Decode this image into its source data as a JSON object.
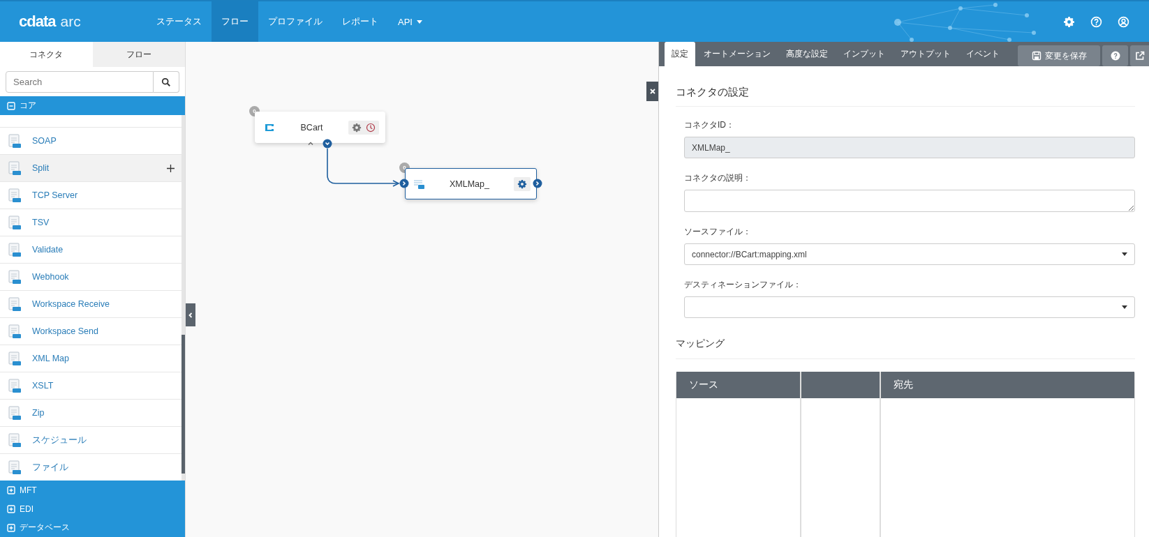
{
  "header": {
    "logo": {
      "brand": "cdata",
      "product": "arc"
    },
    "nav": [
      {
        "label": "ステータス",
        "selected": false,
        "dropdown": false
      },
      {
        "label": "フロー",
        "selected": true,
        "dropdown": false
      },
      {
        "label": "プロファイル",
        "selected": false,
        "dropdown": false
      },
      {
        "label": "レポート",
        "selected": false,
        "dropdown": false
      },
      {
        "label": "API",
        "selected": false,
        "dropdown": true
      }
    ]
  },
  "sidebar": {
    "tabs": [
      {
        "label": "コネクタ",
        "selected": true
      },
      {
        "label": "フロー",
        "selected": false
      }
    ],
    "search": {
      "placeholder": "Search"
    },
    "sections": [
      {
        "label": "コア",
        "expanded": true,
        "items": [
          {
            "label": "SOAP",
            "hovered": false
          },
          {
            "label": "Split",
            "hovered": true
          },
          {
            "label": "TCP Server",
            "hovered": false
          },
          {
            "label": "TSV",
            "hovered": false
          },
          {
            "label": "Validate",
            "hovered": false
          },
          {
            "label": "Webhook",
            "hovered": false
          },
          {
            "label": "Workspace Receive",
            "hovered": false
          },
          {
            "label": "Workspace Send",
            "hovered": false
          },
          {
            "label": "XML Map",
            "hovered": false
          },
          {
            "label": "XSLT",
            "hovered": false
          },
          {
            "label": "Zip",
            "hovered": false
          },
          {
            "label": "スケジュール",
            "hovered": false
          },
          {
            "label": "ファイル",
            "hovered": false
          }
        ]
      },
      {
        "label": "MFT",
        "expanded": false
      },
      {
        "label": "EDI",
        "expanded": false
      },
      {
        "label": "データベース",
        "expanded": false
      }
    ]
  },
  "canvas": {
    "nodes": [
      {
        "label": "BCart",
        "badge": "0",
        "selected": false,
        "schedule": true,
        "incoming": false
      },
      {
        "label": "XMLMap_",
        "badge": "0",
        "selected": true,
        "schedule": false,
        "incoming": true
      }
    ]
  },
  "panel": {
    "tabs": [
      {
        "label": "設定",
        "selected": true
      },
      {
        "label": "オートメーション",
        "selected": false
      },
      {
        "label": "高度な設定",
        "selected": false
      },
      {
        "label": "インプット",
        "selected": false
      },
      {
        "label": "アウトプット",
        "selected": false
      },
      {
        "label": "イベント",
        "selected": false
      }
    ],
    "save_button": "変更を保存",
    "title": "コネクタの設定",
    "fields": [
      {
        "kind": "readonly",
        "label": "コネクタID：",
        "value": "XMLMap_"
      },
      {
        "kind": "textarea",
        "label": "コネクタの説明："
      },
      {
        "kind": "select",
        "label": "ソースファイル：",
        "value": "connector://BCart:mapping.xml"
      },
      {
        "kind": "select",
        "label": "デスティネーションファイル："
      }
    ],
    "mapping": {
      "title": "マッピング",
      "columns": [
        {
          "kind": "text",
          "heading": "ソース"
        },
        {
          "kind": "empty"
        },
        {
          "kind": "text",
          "heading": "宛先"
        }
      ]
    }
  }
}
